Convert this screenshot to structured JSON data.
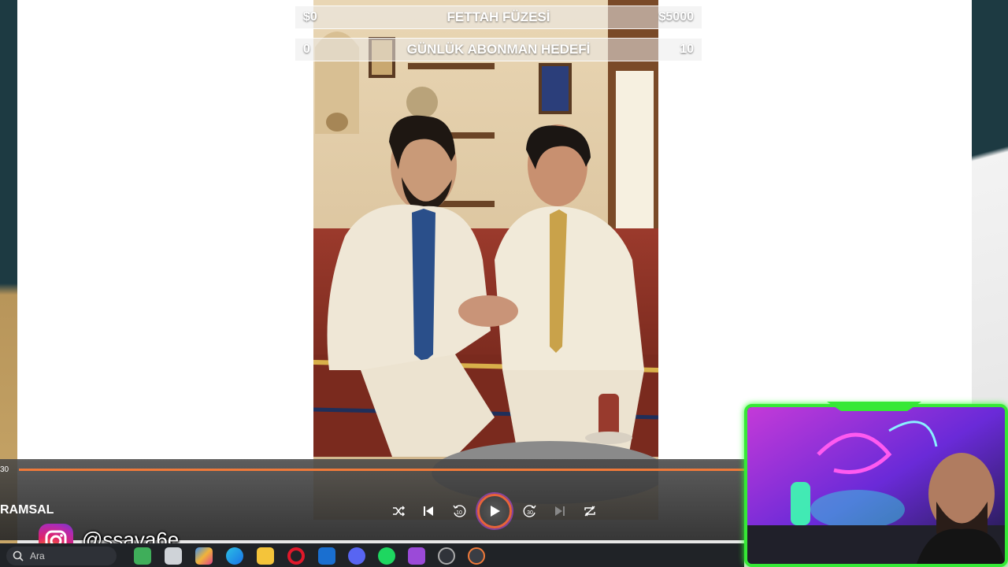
{
  "goals": {
    "rocket": {
      "start": "$0",
      "title": "FETTAH FÜZESİ",
      "target": "$5000"
    },
    "subscribers": {
      "start": "0",
      "title": "GÜNLÜK ABONMAN HEDEFİ",
      "target": "10"
    }
  },
  "player": {
    "time_label": "30",
    "section_label": "RAMSAL",
    "accent_color": "#f07a3a",
    "controls": [
      "shuffle-icon",
      "previous-icon",
      "rewind-10-icon",
      "play-icon",
      "forward-30-icon",
      "next-icon",
      "repeat-icon"
    ],
    "rewind_label": "10",
    "forward_label": "30"
  },
  "instagram": {
    "handle": "@ssava6e"
  },
  "taskbar": {
    "search_placeholder": "Ara",
    "apps": [
      "photos-icon",
      "file-explorer-icon",
      "copilot-icon",
      "edge-icon",
      "folder-icon",
      "opera-icon",
      "outlook-icon",
      "discord-icon",
      "spotify-icon",
      "podcast-icon",
      "obs-icon",
      "media-player-icon"
    ]
  },
  "webcam": {
    "border_color": "#36e836"
  }
}
